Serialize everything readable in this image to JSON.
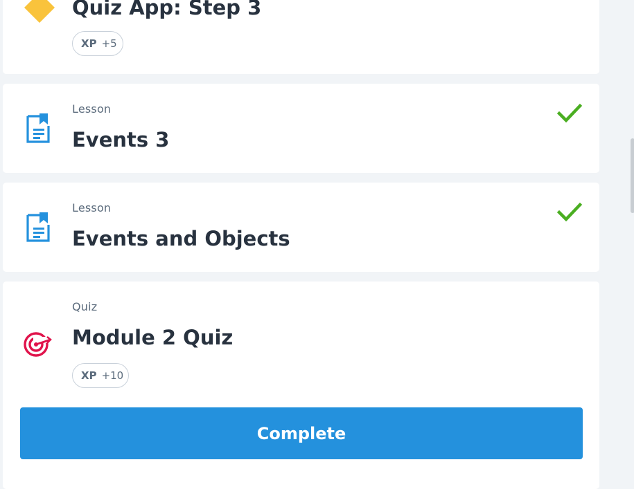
{
  "items": [
    {
      "type_label": "",
      "title": "Quiz App: Step 3",
      "xp_key": "XP",
      "xp_value": "+5",
      "icon": "diamond-icon",
      "completed": false
    },
    {
      "type_label": "Lesson",
      "title": "Events 3",
      "icon": "lesson-doc-icon",
      "completed": true
    },
    {
      "type_label": "Lesson",
      "title": "Events and Objects",
      "icon": "lesson-doc-icon",
      "completed": true
    },
    {
      "type_label": "Quiz",
      "title": "Module 2 Quiz",
      "xp_key": "XP",
      "xp_value": "+10",
      "icon": "target-icon",
      "completed": false
    }
  ],
  "complete_button_label": "Complete",
  "colors": {
    "diamond": "#f9c33c",
    "lesson_icon": "#2491dd",
    "quiz_icon": "#e0134b",
    "check": "#4aae21",
    "button": "#2491dd"
  }
}
